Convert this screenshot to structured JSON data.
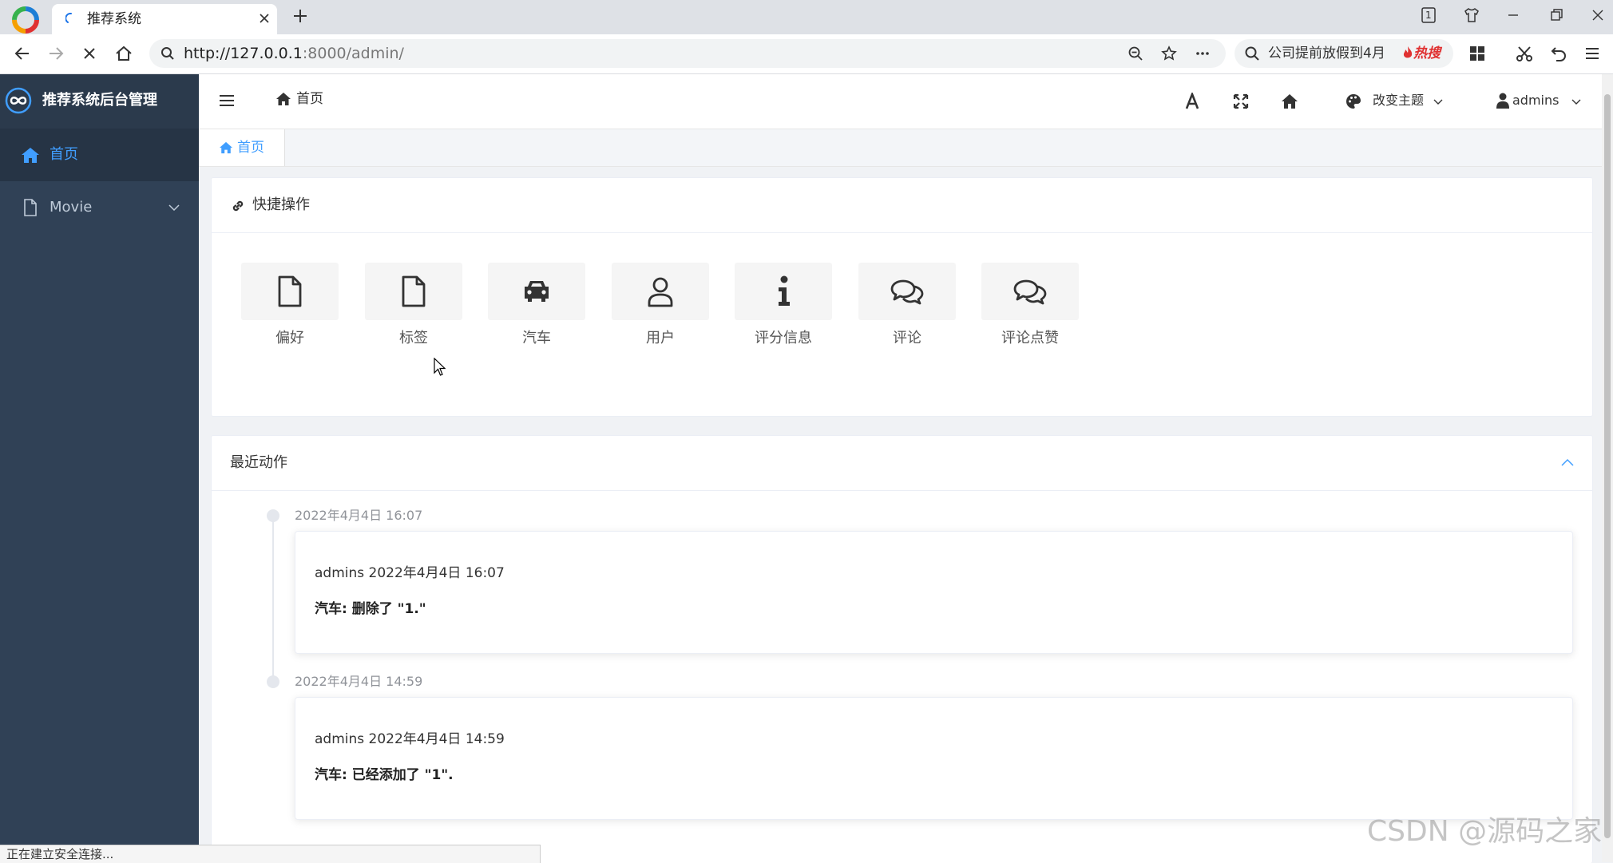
{
  "browser": {
    "tab_title": "推荐系统",
    "url_host": "http://127.0.0.1",
    "url_rest": ":8000/admin/",
    "hot_search": "公司提前放假到4月",
    "hot_badge": "热搜",
    "tab_count": "1",
    "status_text": "正在建立安全连接..."
  },
  "sidebar": {
    "brand": "推荐系统后台管理",
    "items": [
      {
        "label": "首页",
        "icon": "home-icon",
        "active": true
      },
      {
        "label": "Movie",
        "icon": "file-icon",
        "active": false
      }
    ]
  },
  "header": {
    "breadcrumb": "首页",
    "theme_label": "改变主题",
    "user_label": "admins"
  },
  "page_tabs": [
    {
      "label": "首页"
    }
  ],
  "quick_actions": {
    "title": "快捷操作",
    "items": [
      {
        "label": "偏好",
        "icon": "file-icon"
      },
      {
        "label": "标签",
        "icon": "file-icon"
      },
      {
        "label": "汽车",
        "icon": "car-icon"
      },
      {
        "label": "用户",
        "icon": "user-icon"
      },
      {
        "label": "评分信息",
        "icon": "info-icon"
      },
      {
        "label": "评论",
        "icon": "comments-icon"
      },
      {
        "label": "评论点赞",
        "icon": "comments-icon"
      }
    ]
  },
  "recent_actions": {
    "title": "最近动作",
    "items": [
      {
        "time": "2022年4月4日 16:07",
        "author": "admins 2022年4月4日 16:07",
        "action": "汽车: 删除了 \"1.\""
      },
      {
        "time": "2022年4月4日 14:59",
        "author": "admins 2022年4月4日 14:59",
        "action": "汽车: 已经添加了 \"1\"."
      }
    ]
  },
  "watermark": "CSDN @源码之家",
  "colors": {
    "sidebar_bg": "#304156",
    "brand_bg": "#2b3a4c",
    "active_bg": "#263445",
    "accent": "#409eff"
  }
}
